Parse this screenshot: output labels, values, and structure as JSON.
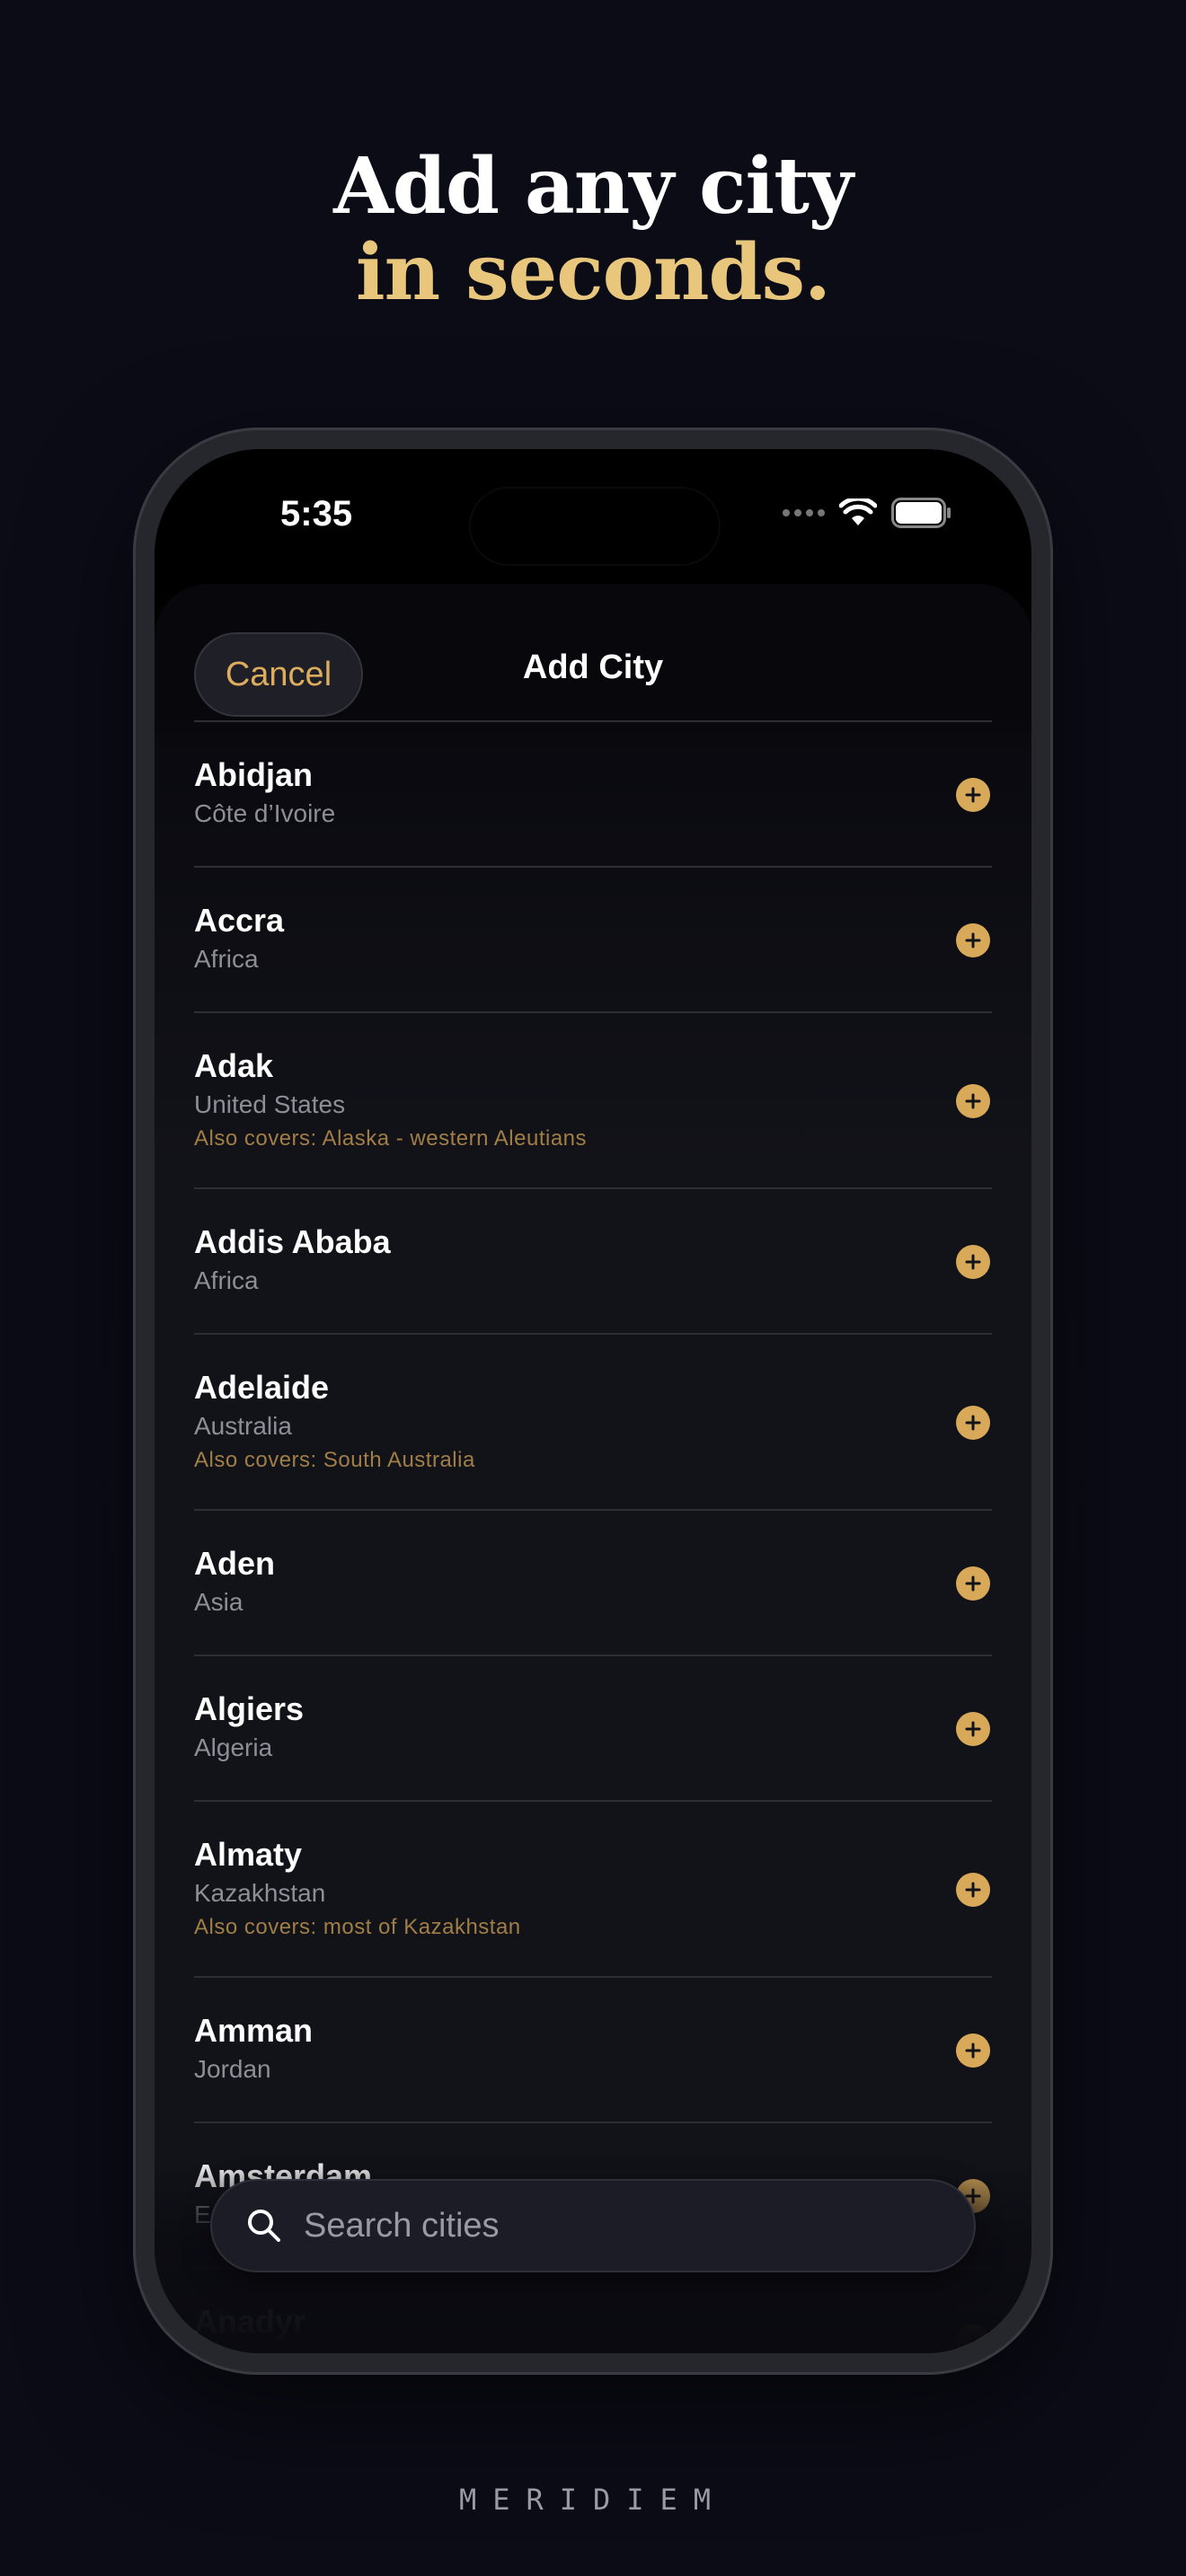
{
  "headline": {
    "line1": "Add any city",
    "line2": "in seconds."
  },
  "status": {
    "time": "5:35"
  },
  "nav": {
    "cancel_label": "Cancel",
    "title": "Add City"
  },
  "cities": [
    {
      "name": "Abidjan",
      "region": "Côte d’Ivoire",
      "covers": ""
    },
    {
      "name": "Accra",
      "region": "Africa",
      "covers": ""
    },
    {
      "name": "Adak",
      "region": "United States",
      "covers": "Also covers: Alaska - western Aleutians"
    },
    {
      "name": "Addis Ababa",
      "region": "Africa",
      "covers": ""
    },
    {
      "name": "Adelaide",
      "region": "Australia",
      "covers": "Also covers: South Australia"
    },
    {
      "name": "Aden",
      "region": "Asia",
      "covers": ""
    },
    {
      "name": "Algiers",
      "region": "Algeria",
      "covers": ""
    },
    {
      "name": "Almaty",
      "region": "Kazakhstan",
      "covers": "Also covers: most of Kazakhstan"
    },
    {
      "name": "Amman",
      "region": "Jordan",
      "covers": ""
    },
    {
      "name": "Amsterdam",
      "region": "Europe",
      "covers": ""
    },
    {
      "name": "Anadyr",
      "region": "",
      "covers": ""
    }
  ],
  "search": {
    "placeholder": "Search cities"
  },
  "brand": "MERIDIEM",
  "colors": {
    "background": "#0c0c17",
    "accent": "#e8c77c",
    "button": "#d8a959"
  },
  "icons": {
    "search": "search-icon",
    "add": "plus-circle-icon",
    "wifi": "wifi-icon",
    "battery": "battery-icon"
  }
}
